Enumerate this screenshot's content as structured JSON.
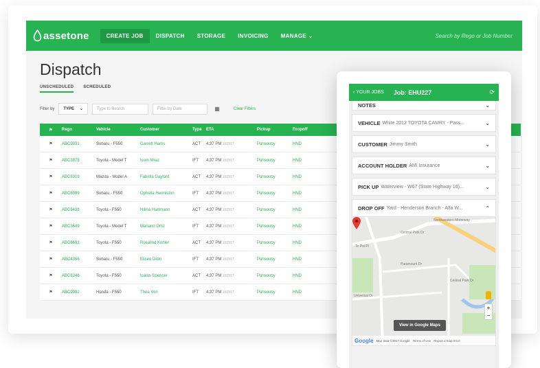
{
  "app": {
    "brand": "assetone",
    "search_placeholder": "Search by Rego or Job Number"
  },
  "nav": [
    {
      "label": "CREATE JOB",
      "active": true
    },
    {
      "label": "DISPATCH",
      "active": false
    },
    {
      "label": "STORAGE",
      "active": false
    },
    {
      "label": "INVOICING",
      "active": false
    },
    {
      "label": "MANAGE ⌄",
      "active": false
    }
  ],
  "page": {
    "title": "Dispatch"
  },
  "subtabs": [
    {
      "label": "UNSCHEDULED",
      "active": true
    },
    {
      "label": "SCHEDULED",
      "active": false
    }
  ],
  "filters": {
    "filter_label": "Filter by",
    "type_value": "TYPE",
    "type_placeholder": "Type to Search",
    "date_placeholder": "Filter by Date",
    "clear_label": "Clear Filters"
  },
  "table": {
    "headers": [
      "⚑",
      "Rego",
      "Vehicle",
      "Customer",
      "Type",
      "ETA",
      "Pickup",
      "Dropoff"
    ],
    "rows": [
      {
        "rego": "ABC9331",
        "vehicle": "Subaru - F550",
        "customer": "Garrett Harris",
        "type": "ACT",
        "eta": "4:37 PM",
        "eta_date": "16/2/17",
        "pickup": "Ponsonby",
        "dropoff": "HND"
      },
      {
        "rego": "ABC3875",
        "vehicle": "Toyota - Model T",
        "customer": "Isom Mraz",
        "type": "IFT",
        "eta": "4:37 PM",
        "eta_date": "16/2/17",
        "pickup": "Ponsonby",
        "dropoff": "HND"
      },
      {
        "rego": "ABC8319",
        "vehicle": "Mazda - Model A",
        "customer": "Fabiola Gaylord",
        "type": "ACT",
        "eta": "4:37 PM",
        "eta_date": "16/2/17",
        "pickup": "Ponsonby",
        "dropoff": "HND"
      },
      {
        "rego": "ABC6099",
        "vehicle": "Subaru - F550",
        "customer": "Ophelia Hermiston",
        "type": "IFT",
        "eta": "4:37 PM",
        "eta_date": "16/2/17",
        "pickup": "Ponsonby",
        "dropoff": "HND"
      },
      {
        "rego": "ABC8438",
        "vehicle": "Toyota - F550",
        "customer": "Hilma Hartmann",
        "type": "ACT",
        "eta": "4:37 PM",
        "eta_date": "16/2/17",
        "pickup": "Ponsonby",
        "dropoff": "HND"
      },
      {
        "rego": "ABC3649",
        "vehicle": "Toyota - Model T",
        "customer": "Mariano Ortiz",
        "type": "IFT",
        "eta": "4:37 PM",
        "eta_date": "16/2/17",
        "pickup": "Ponsonby",
        "dropoff": "HND"
      },
      {
        "rego": "ABC6693",
        "vehicle": "Toyota - F550",
        "customer": "Rosalind Kohler",
        "type": "ACT",
        "eta": "4:37 PM",
        "eta_date": "16/2/17",
        "pickup": "Ponsonby",
        "dropoff": "HND"
      },
      {
        "rego": "ABC4356",
        "vehicle": "Subaru - F550",
        "customer": "Eliseo Dicki",
        "type": "IFT",
        "eta": "4:37 PM",
        "eta_date": "16/2/17",
        "pickup": "Ponsonby",
        "dropoff": "HND"
      },
      {
        "rego": "ABC8246",
        "vehicle": "Toyota - F550",
        "customer": "Isaias Spencer",
        "type": "ACT",
        "eta": "4:37 PM",
        "eta_date": "16/2/17",
        "pickup": "Ponsonby",
        "dropoff": "HND"
      },
      {
        "rego": "ABC9982",
        "vehicle": "Honda - F550",
        "customer": "Thea Von",
        "type": "IFT",
        "eta": "4:37 PM",
        "eta_date": "16/2/17",
        "pickup": "Ponsonby",
        "dropoff": "HND"
      }
    ]
  },
  "mobile": {
    "back_label": "YOUR JOBS",
    "job_title": "Job: EHU227",
    "sections": [
      {
        "key": "notes",
        "label": "NOTES",
        "value": ""
      },
      {
        "key": "vehicle",
        "label": "VEHICLE",
        "value": "White 2012 TOYOTA CAMRY - Pass..."
      },
      {
        "key": "customer",
        "label": "CUSTOMER",
        "value": "Jimmy Smith"
      },
      {
        "key": "account",
        "label": "ACCOUNT HOLDER",
        "value": "AMI Insurance"
      },
      {
        "key": "pickup",
        "label": "PICK UP",
        "value": "Waterview - W67 (State Highway 16)..."
      },
      {
        "key": "dropoff",
        "label": "DROP OFF",
        "value": "Yard - Henderson Branch - Alfa W..."
      }
    ],
    "map": {
      "button_label": "View in Google Maps",
      "footer_data": "Map data ©2017 Google",
      "footer_terms": "Terms of Use",
      "footer_report": "Report a map error",
      "google": "Google",
      "streets": [
        "Central Park Dr",
        "Paramount Dr",
        "Northwestern Motorway",
        "Central Park Dr",
        "Universal Dr",
        "Te Pai Pl"
      ]
    }
  },
  "colors": {
    "brand_green": "#27b352",
    "brand_green_dark": "#1e9a44",
    "pin_red": "#e53935"
  }
}
